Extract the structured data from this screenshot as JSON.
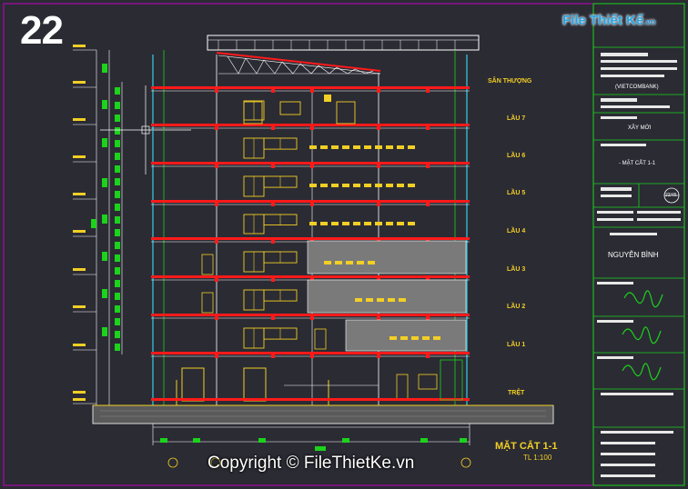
{
  "page_number": "22",
  "logo": {
    "text": "File Thiết Kế",
    "suffix": ".vn"
  },
  "levels": [
    "SÂN THƯỢNG",
    "LẦU 7",
    "LẦU 6",
    "LẦU 5",
    "LẦU 4",
    "LẦU 3",
    "LẦU 2",
    "LẦU 1",
    "TRỆT"
  ],
  "section": {
    "title": "MẶT CẮT 1-1",
    "scale": "TL 1:100"
  },
  "title_block": {
    "bank": "(VIETCOMBANK)",
    "work": "XÂY MỚI",
    "drawing": "- MẶT CẮT 1-1",
    "sheet": "22/45",
    "designer": "NGUYỄN BÌNH"
  },
  "watermark": "Copyright © FileThietKe.vn",
  "colors": {
    "background": "#2b2b34",
    "slab": "#ff1a1a",
    "wall": "#ffffff",
    "green": "#1bd31b",
    "yellow": "#f2cf24",
    "cyan": "#35d0e6",
    "frame": "#c000c0"
  }
}
